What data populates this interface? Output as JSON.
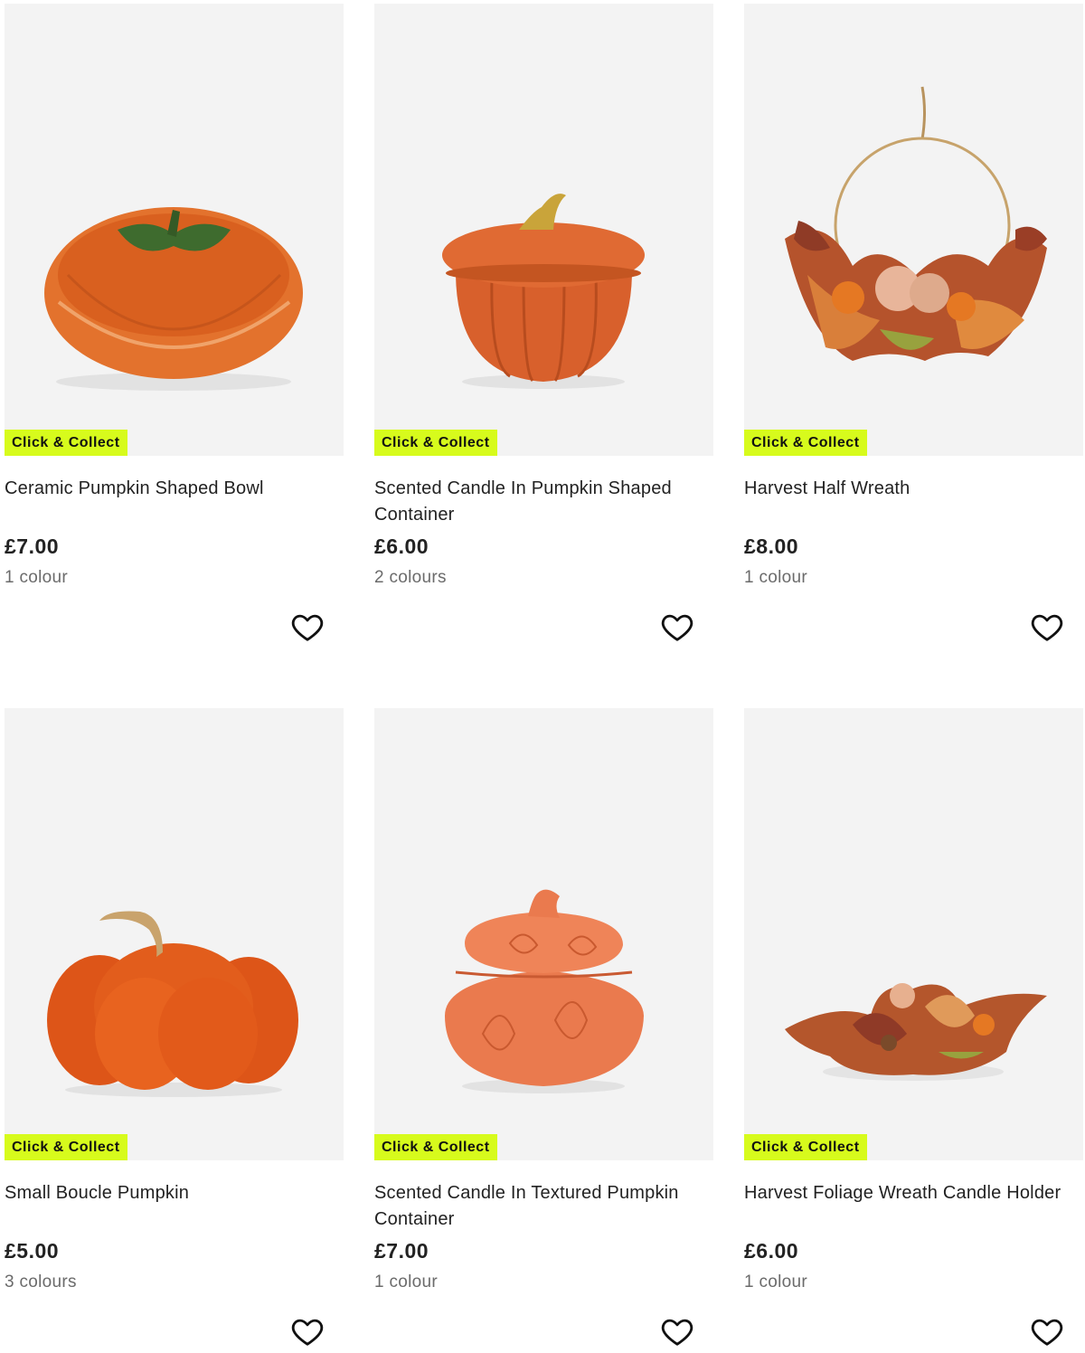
{
  "products": [
    {
      "badge": "Click & Collect",
      "title": "Ceramic Pumpkin Shaped Bowl",
      "price": "£7.00",
      "colours": "1 colour"
    },
    {
      "badge": "Click & Collect",
      "title": "Scented Candle In Pumpkin Shaped Container",
      "price": "£6.00",
      "colours": "2 colours"
    },
    {
      "badge": "Click & Collect",
      "title": "Harvest Half Wreath",
      "price": "£8.00",
      "colours": "1 colour"
    },
    {
      "badge": "Click & Collect",
      "title": "Small Boucle Pumpkin",
      "price": "£5.00",
      "colours": "3 colours"
    },
    {
      "badge": "Click & Collect",
      "title": "Scented Candle In Textured Pumpkin Container",
      "price": "£7.00",
      "colours": "1 colour"
    },
    {
      "badge": "Click & Collect",
      "title": "Harvest Foliage Wreath Candle Holder",
      "price": "£6.00",
      "colours": "1 colour"
    }
  ],
  "icons": {
    "wishlist": "heart-outline-icon"
  },
  "colors": {
    "badge_bg": "#d7fb1c",
    "image_bg": "#f3f3f3",
    "muted_text": "#6b6b6b"
  }
}
